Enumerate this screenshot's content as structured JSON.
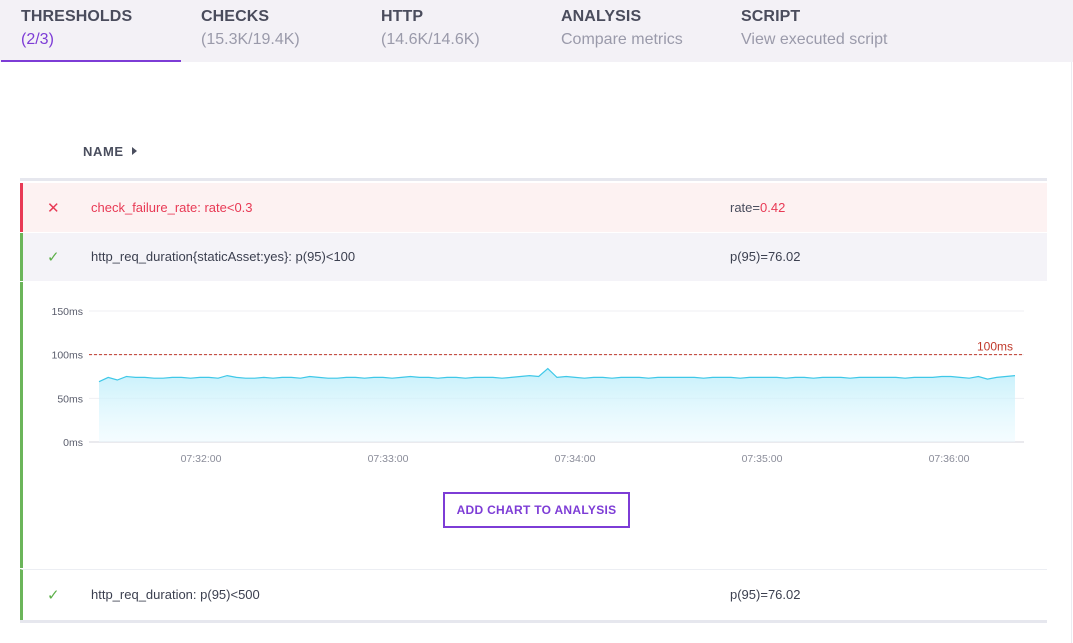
{
  "tabs": [
    {
      "title": "THRESHOLDS",
      "sub": "(2/3)"
    },
    {
      "title": "CHECKS",
      "sub": "(15.3K/19.4K)"
    },
    {
      "title": "HTTP",
      "sub": "(14.6K/14.6K)"
    },
    {
      "title": "ANALYSIS",
      "sub": "Compare metrics"
    },
    {
      "title": "SCRIPT",
      "sub": "View executed script"
    }
  ],
  "table": {
    "name_header": "NAME",
    "rows": [
      {
        "icon": "close-icon",
        "name": "check_failure_rate: rate<0.3",
        "value_prefix": "rate=",
        "value": "0.42",
        "status": "failed"
      },
      {
        "icon": "check-icon",
        "name": "http_req_duration{staticAsset:yes}: p(95)<100",
        "value_prefix": "p(95)=",
        "value": "76.02",
        "status": "passed"
      },
      {
        "icon": "check-icon",
        "name": "http_req_duration: p(95)<500",
        "value_prefix": "p(95)=",
        "value": "76.02",
        "status": "passed"
      }
    ]
  },
  "chart_data": {
    "type": "area",
    "ylim": [
      0,
      150
    ],
    "y_ticks": [
      "0ms",
      "50ms",
      "100ms",
      "150ms"
    ],
    "x_ticks": [
      "07:32:00",
      "07:33:00",
      "07:34:00",
      "07:35:00",
      "07:36:00"
    ],
    "threshold": {
      "value": 100,
      "label": "100ms",
      "color": "#c0392b"
    },
    "series": [
      {
        "color": "#3fc8e8",
        "values": [
          69,
          74,
          71,
          75,
          74,
          74,
          73,
          73,
          74,
          74,
          73,
          74,
          74,
          73,
          76,
          74,
          73,
          73,
          74,
          73,
          74,
          74,
          73,
          75,
          74,
          73,
          73,
          74,
          74,
          73,
          74,
          74,
          73,
          74,
          75,
          74,
          74,
          73,
          74,
          74,
          73,
          74,
          74,
          74,
          73,
          74,
          75,
          76,
          75,
          84,
          74,
          75,
          74,
          73,
          74,
          74,
          73,
          74,
          74,
          74,
          73,
          74,
          74,
          74,
          74,
          74,
          73,
          74,
          74,
          74,
          73,
          74,
          74,
          74,
          74,
          73,
          74,
          74,
          73,
          74,
          74,
          74,
          73,
          74,
          74,
          74,
          74,
          74,
          73,
          74,
          74,
          74,
          75,
          75,
          74,
          73,
          75,
          72,
          74,
          75,
          76
        ]
      }
    ]
  },
  "actions": {
    "add_chart": "ADD CHART TO ANALYSIS"
  }
}
